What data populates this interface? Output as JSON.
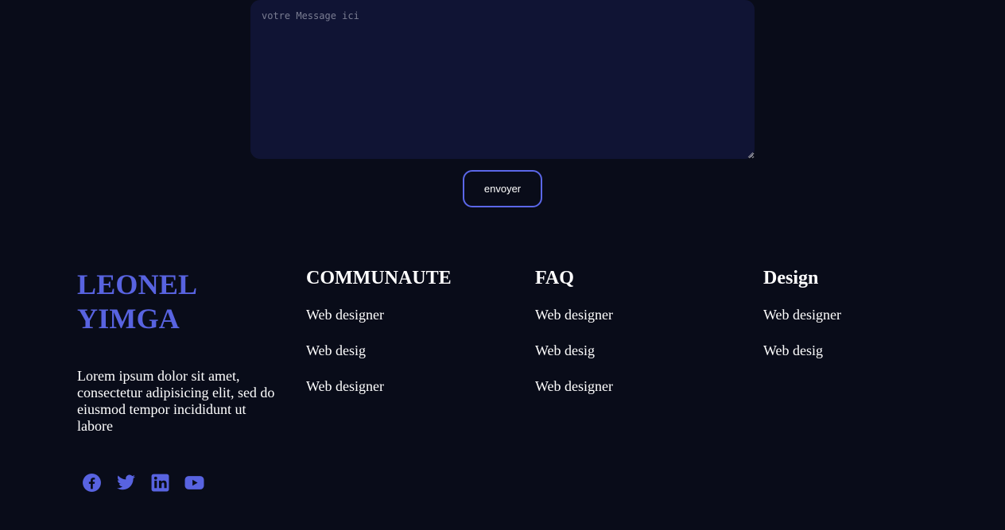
{
  "contact_form": {
    "message_placeholder": "votre Message ici",
    "message_value": "",
    "send_label": "envoyer"
  },
  "footer": {
    "brand": {
      "title_line1": "LEONEL",
      "title_line2": "YIMGA",
      "description": "Lorem ipsum dolor sit amet, consectetur adipisicing elit, sed do eiusmod tempor incididunt ut labore"
    },
    "socials": [
      {
        "name": "facebook-icon"
      },
      {
        "name": "twitter-icon"
      },
      {
        "name": "linkedin-icon"
      },
      {
        "name": "youtube-icon"
      }
    ],
    "columns": [
      {
        "heading": "COMMUNAUTE",
        "links": [
          "Web designer",
          "Web desig",
          "Web designer"
        ]
      },
      {
        "heading": "FAQ",
        "links": [
          "Web designer",
          "Web desig",
          "Web designer"
        ]
      },
      {
        "heading": "Design",
        "links": [
          "Web designer",
          "Web desig"
        ]
      }
    ]
  },
  "colors": {
    "background": "#090c19",
    "textarea_bg": "#101434",
    "accent": "#5863e0",
    "button_border": "#5b67e8",
    "text": "#ffffff"
  }
}
